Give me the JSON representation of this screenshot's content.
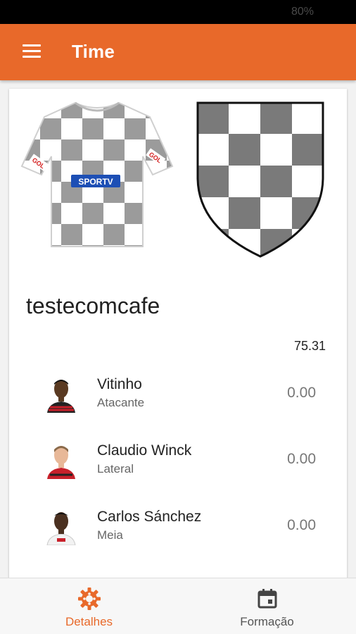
{
  "status_bar": {
    "battery": "80%"
  },
  "app_bar": {
    "title": "Time"
  },
  "team": {
    "name": "testecomcafe",
    "total_points": "75.31",
    "jersey_sponsor": "SPORTV",
    "jersey_brand": "GOL"
  },
  "players": [
    {
      "name": "Vitinho",
      "position": "Atacante",
      "points": "0.00"
    },
    {
      "name": "Claudio Winck",
      "position": "Lateral",
      "points": "0.00"
    },
    {
      "name": "Carlos Sánchez",
      "position": "Meia",
      "points": "0.00"
    }
  ],
  "bottom_nav": [
    {
      "label": "Detalhes",
      "icon": "gear-icon",
      "active": true
    },
    {
      "label": "Formação",
      "icon": "calendar-icon",
      "active": false
    }
  ],
  "colors": {
    "accent": "#e8692a",
    "checker_dark": "#7a7a7a"
  }
}
